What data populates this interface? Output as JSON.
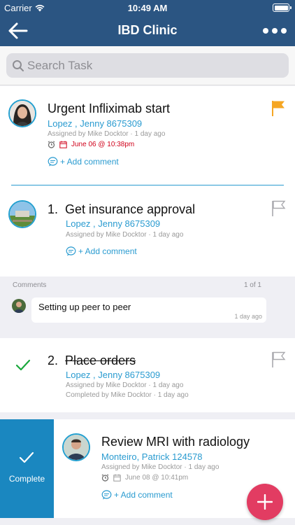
{
  "status_bar": {
    "carrier": "Carrier",
    "time": "10:49 AM"
  },
  "nav": {
    "title": "IBD Clinic",
    "back_icon": "arrow-left-icon",
    "more_icon": "more-dots-icon"
  },
  "search": {
    "placeholder": "Search Task",
    "value": ""
  },
  "tasks": [
    {
      "title": "Urgent Infliximab start",
      "patient": "Lopez , Jenny  8675309",
      "assigned": "Assigned by Mike Docktor · 1 day ago",
      "due": "June 06 @ 10:38pm",
      "add_comment": "+ Add comment",
      "flag_color": "#f5a623"
    },
    {
      "number": "1.",
      "title": "Get insurance approval",
      "patient": "Lopez , Jenny  8675309",
      "assigned": "Assigned by Mike Docktor · 1 day ago",
      "add_comment": "+ Add comment",
      "flag_color": "#c7c7cc"
    },
    {
      "number": "2.",
      "title": "Place orders",
      "patient": "Lopez , Jenny  8675309",
      "assigned": "Assigned by Mike Docktor · 1 day ago",
      "completed": "Completed by Mike Docktor · 1 day ago",
      "flag_color": "#c7c7cc",
      "check_color": "#19a83c"
    },
    {
      "title": "Review MRI with radiology",
      "patient": "Monteiro, Patrick 124578",
      "assigned": "Assigned by Mike Docktor · 1 day ago",
      "due": "June 08 @ 10:41pm",
      "add_comment": "+ Add comment"
    }
  ],
  "comments": {
    "header": "Comments",
    "count": "1 of 1",
    "items": [
      {
        "text": "Setting up peer to peer",
        "time": "1 day ago"
      }
    ]
  },
  "swipe_action": {
    "label": "Complete",
    "color": "#1a87c0"
  },
  "fab": {
    "icon": "plus-icon",
    "color": "#e23c62"
  },
  "colors": {
    "nav": "#2b5582",
    "accent": "#2a9bd0",
    "due_red": "#d0021b"
  }
}
